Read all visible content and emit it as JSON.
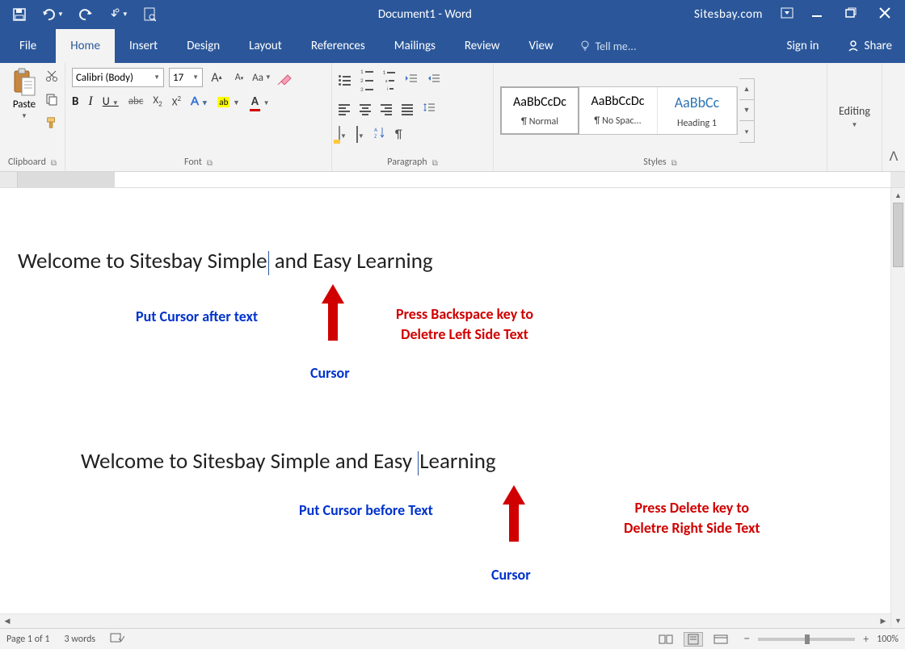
{
  "titlebar": {
    "document_title": "Document1 - Word",
    "site": "Sitesbay.com"
  },
  "tabs": {
    "file": "File",
    "home": "Home",
    "insert": "Insert",
    "design": "Design",
    "layout": "Layout",
    "references": "References",
    "mailings": "Mailings",
    "review": "Review",
    "view": "View",
    "tell_me": "Tell me...",
    "signin": "Sign in",
    "share": "Share"
  },
  "ribbon": {
    "clipboard": {
      "paste": "Paste",
      "label": "Clipboard"
    },
    "font": {
      "name": "Calibri (Body)",
      "size": "17",
      "label": "Font"
    },
    "paragraph": {
      "label": "Paragraph"
    },
    "styles": {
      "label": "Styles",
      "items": [
        {
          "preview": "AaBbCcDc",
          "name": "¶ Normal"
        },
        {
          "preview": "AaBbCcDc",
          "name": "¶ No Spac..."
        },
        {
          "preview": "AaBbCc",
          "name": "Heading 1"
        }
      ]
    },
    "editing": {
      "label": "Editing"
    }
  },
  "document": {
    "line1_a": "Welcome to Sitesbay Simple",
    "line1_b": " and Easy Learning",
    "anno1_put": "Put Cursor after text",
    "anno1_cursor": "Cursor",
    "anno1_press": "Press Backspace key to\nDeletre Left Side Text",
    "line2_a": "Welcome to Sitesbay Simple and Easy ",
    "line2_b": "Learning",
    "anno2_put": "Put Cursor before Text",
    "anno2_cursor": "Cursor",
    "anno2_press": "Press Delete key to\nDeletre Right Side Text"
  },
  "statusbar": {
    "page": "Page 1 of 1",
    "words": "3 words",
    "zoom": "100%"
  }
}
